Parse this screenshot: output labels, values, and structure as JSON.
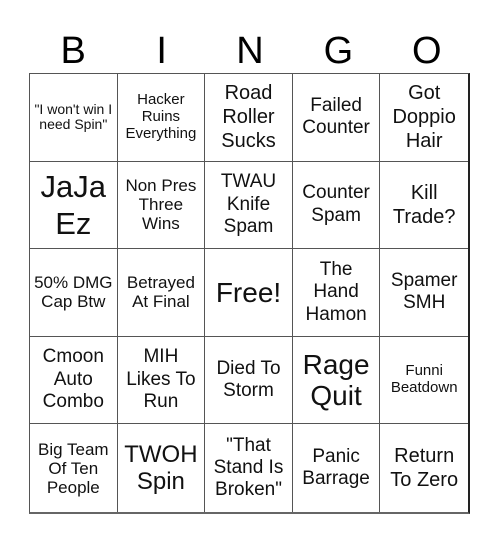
{
  "header": {
    "letters": [
      "B",
      "I",
      "N",
      "G",
      "O"
    ]
  },
  "cells": [
    {
      "text": "\"I won't win I need Spin\""
    },
    {
      "text": "Hacker Ruins Everything"
    },
    {
      "text": "Road Roller Sucks"
    },
    {
      "text": "Failed Counter"
    },
    {
      "text": "Got Doppio Hair"
    },
    {
      "text": "JaJa Ez"
    },
    {
      "text": "Non Pres Three Wins"
    },
    {
      "text": "TWAU Knife Spam"
    },
    {
      "text": "Counter Spam"
    },
    {
      "text": "Kill Trade?"
    },
    {
      "text": "50% DMG Cap Btw"
    },
    {
      "text": "Betrayed At Final"
    },
    {
      "text": "Free!"
    },
    {
      "text": "The Hand Hamon"
    },
    {
      "text": "Spamer SMH"
    },
    {
      "text": "Cmoon Auto Combo"
    },
    {
      "text": "MIH Likes To Run"
    },
    {
      "text": "Died To Storm"
    },
    {
      "text": "Rage Quit"
    },
    {
      "text": "Funni Beatdown"
    },
    {
      "text": "Big Team Of Ten People"
    },
    {
      "text": "TWOH Spin"
    },
    {
      "text": "\"That Stand Is Broken\""
    },
    {
      "text": "Panic Barrage"
    },
    {
      "text": "Return To Zero"
    }
  ]
}
